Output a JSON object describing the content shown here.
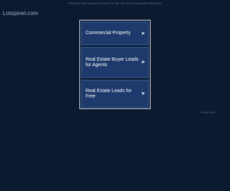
{
  "header": {
    "site_name": "Lotopinet.com",
    "notice": "The domain name lotopinet.com may be for sale. Click here to inquire about this domain."
  },
  "links": [
    {
      "label": "Commercial Property",
      "icon": "arrow-right-icon",
      "glyph": "➤"
    },
    {
      "label": "Real Estate Buyer Leads for Agents",
      "icon": "arrow-right-icon",
      "glyph": "➤"
    },
    {
      "label": "Real Estate Leads for Free",
      "icon": "arrow-right-icon",
      "glyph": "➤"
    }
  ],
  "footer": {
    "privacy": "Privacy Policy"
  },
  "colors": {
    "background": "#0b1a2e",
    "link_background": "#1e3a6c",
    "panel_border": "#d4dbe3"
  }
}
